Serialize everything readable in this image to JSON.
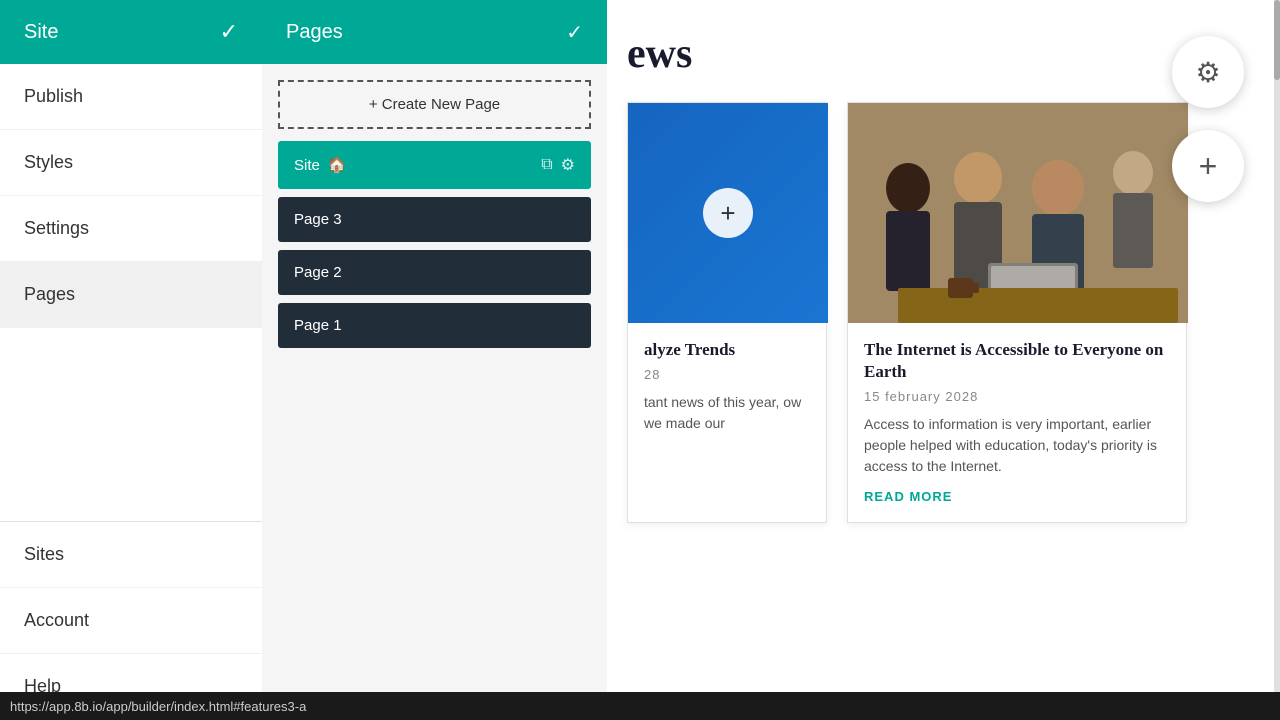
{
  "sidebar": {
    "title": "Site",
    "check_icon": "✓",
    "items": [
      {
        "id": "publish",
        "label": "Publish",
        "active": false
      },
      {
        "id": "styles",
        "label": "Styles",
        "active": false
      },
      {
        "id": "settings",
        "label": "Settings",
        "active": false
      },
      {
        "id": "pages",
        "label": "Pages",
        "active": true
      },
      {
        "id": "sites",
        "label": "Sites",
        "active": false
      },
      {
        "id": "account",
        "label": "Account",
        "active": false
      },
      {
        "id": "help",
        "label": "Help",
        "active": false
      }
    ]
  },
  "pages_panel": {
    "title": "Pages",
    "check_icon": "✓",
    "create_button_label": "+ Create New Page",
    "pages": [
      {
        "id": "site",
        "label": "Site",
        "is_site": true
      },
      {
        "id": "page3",
        "label": "Page 3",
        "is_site": false
      },
      {
        "id": "page2",
        "label": "Page 2",
        "is_site": false
      },
      {
        "id": "page1",
        "label": "Page 1",
        "is_site": false
      }
    ]
  },
  "main": {
    "news_title": "ews",
    "cards": [
      {
        "id": "card-blue",
        "type": "blue",
        "add_icon": "+"
      },
      {
        "id": "card-business",
        "type": "image",
        "title": "The Internet is Accessible to Everyone on Earth",
        "date": "15 february 2028",
        "text": "Access to information is very important, earlier people helped with education, today's priority is access to the Internet.",
        "read_more": "READ MORE"
      }
    ]
  },
  "left_card_partial": {
    "title_partial": "alyze Trends",
    "date_partial": "28",
    "text_partial": "tant news of this year, ow we made our"
  },
  "fab": {
    "settings_icon": "⚙",
    "add_icon": "+"
  },
  "status_bar": {
    "url": "https://app.8b.io/app/builder/index.html#features3-a"
  },
  "colors": {
    "teal": "#00a896",
    "dark_navy": "#222d3a",
    "white": "#ffffff"
  }
}
